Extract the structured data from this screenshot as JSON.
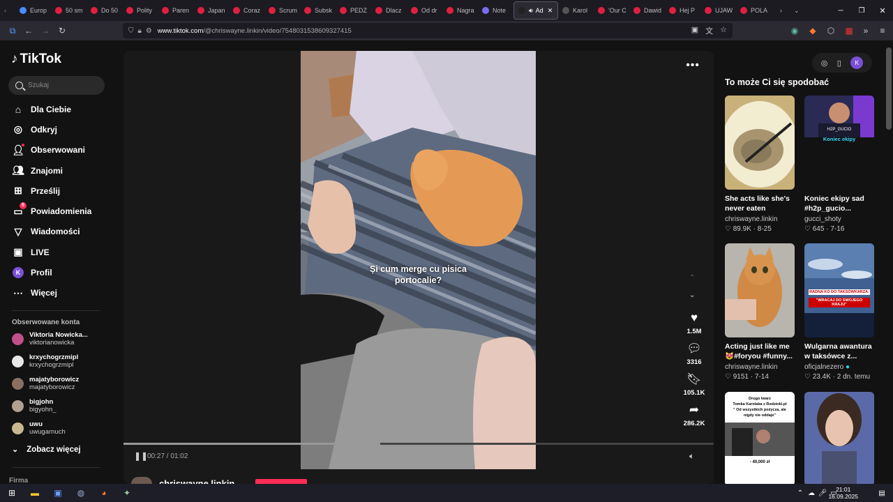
{
  "browser": {
    "tabs": [
      {
        "label": "Europ",
        "icon": "globe-icon",
        "color": "#4a8cff"
      },
      {
        "label": "50 sm",
        "icon": "youtube-icon",
        "color": "#e02040"
      },
      {
        "label": "Do 50",
        "icon": "youtube-icon",
        "color": "#e02040"
      },
      {
        "label": "Polity",
        "icon": "youtube-icon",
        "color": "#e02040"
      },
      {
        "label": "Paren",
        "icon": "youtube-icon",
        "color": "#e02040"
      },
      {
        "label": "Japan",
        "icon": "youtube-icon",
        "color": "#e02040"
      },
      {
        "label": "Coraz",
        "icon": "youtube-icon",
        "color": "#e02040"
      },
      {
        "label": "Scrum",
        "icon": "youtube-icon",
        "color": "#e02040"
      },
      {
        "label": "Subsk",
        "icon": "youtube-icon",
        "color": "#e02040"
      },
      {
        "label": "PEDZ",
        "icon": "youtube-icon",
        "color": "#e02040"
      },
      {
        "label": "Dlacz",
        "icon": "youtube-icon",
        "color": "#e02040"
      },
      {
        "label": "Od dr",
        "icon": "youtube-icon",
        "color": "#e02040"
      },
      {
        "label": "Nagra",
        "icon": "youtube-icon",
        "color": "#e02040"
      },
      {
        "label": "Note",
        "icon": "notebook-icon",
        "color": "#7a6cf0"
      },
      {
        "label": "Ad",
        "icon": "tiktok-icon",
        "color": "#222222",
        "active": true
      },
      {
        "label": "Karol",
        "icon": "x-icon",
        "color": "#555555"
      },
      {
        "label": "'Our C",
        "icon": "youtube-icon",
        "color": "#e02040"
      },
      {
        "label": "Dawid",
        "icon": "youtube-icon",
        "color": "#e02040"
      },
      {
        "label": "Hej P",
        "icon": "youtube-icon",
        "color": "#e02040"
      },
      {
        "label": "UJAW",
        "icon": "youtube-icon",
        "color": "#e02040"
      },
      {
        "label": "POLA",
        "icon": "youtube-icon",
        "color": "#e02040"
      }
    ],
    "url_host": "www.tiktok.com",
    "url_path": "/@chriswayne.linkin/video/7548031538609327415"
  },
  "sidebar": {
    "logo": "TikTok",
    "search_placeholder": "Szukaj",
    "menu": [
      {
        "label": "Dla Ciebie",
        "icon": "home-icon"
      },
      {
        "label": "Odkryj",
        "icon": "compass-icon"
      },
      {
        "label": "Obserwowani",
        "icon": "following-icon"
      },
      {
        "label": "Znajomi",
        "icon": "friends-icon"
      },
      {
        "label": "Prześlij",
        "icon": "upload-icon"
      },
      {
        "label": "Powiadomienia",
        "icon": "inbox-icon",
        "badge": "5"
      },
      {
        "label": "Wiadomości",
        "icon": "messages-icon"
      },
      {
        "label": "LIVE",
        "icon": "live-icon"
      },
      {
        "label": "Profil",
        "icon": "profile-avatar",
        "avatar_letter": "K"
      },
      {
        "label": "Więcej",
        "icon": "more-icon"
      }
    ],
    "followed_header": "Obserwowane konta",
    "followed": [
      {
        "name": "Viktoria Nowicka...",
        "handle": "viktorianowicka",
        "color": "#c0508a"
      },
      {
        "name": "krxychogrzmipl",
        "handle": "krxychogrzmipl",
        "color": "#e8e8e8"
      },
      {
        "name": "majatyborowicz",
        "handle": "majatyborowicz",
        "color": "#8a7060"
      },
      {
        "name": "bigjohn",
        "handle": "bigyohn_",
        "color": "#b0a090"
      },
      {
        "name": "uwu",
        "handle": "uwugarnuch",
        "color": "#c8b890"
      }
    ],
    "see_more": "Zobacz więcej",
    "company": "Firma"
  },
  "video": {
    "caption_line1": "Și cum merge cu pisica",
    "caption_line2": "portocalie?",
    "likes": "1.5M",
    "comments": "3316",
    "saves": "105.1K",
    "shares": "286.2K",
    "time": "00:27 / 01:02",
    "progress": 0.435,
    "author": "chriswayne.linkin"
  },
  "recommend": {
    "title": "To może Ci się spodobać",
    "items": [
      {
        "title": "She acts like she's never eaten before...",
        "author": "chriswayne.linkin",
        "likes": "89.9K",
        "date": "8-25"
      },
      {
        "title": "Koniec ekipy sad #h2p_gucio...",
        "author": "gucci_shoty",
        "likes": "645",
        "date": "7-16",
        "thumb_text": "Koniec ekipy",
        "thumb_tag": "H2P_GUCIO"
      },
      {
        "title": "Acting just like me 😻#foryou #funny...",
        "author": "chriswayne.linkin",
        "likes": "9151",
        "date": "7-14"
      },
      {
        "title": "Wulgarna awantura w taksówce z...",
        "author": "oficjalnezero",
        "likes": "23.4K",
        "date": "2 dn. temu",
        "verified": true,
        "thumb_text1": "RADNA KO DO TAKSÓWKARZA:",
        "thumb_text2": "\"WRACAJ DO SWOJEGO KRAJU\""
      },
      {
        "title": "",
        "author": "",
        "likes": "",
        "date": "",
        "thumb_text1": "Drugo twarz",
        "thumb_text2": "Tomka Karolaka z Rodzinki.pl",
        "thumb_text3": "\" Od wszystkich pożycza, ale nigdy nie oddaje\"",
        "thumb_text4": "- 40,000 zł"
      },
      {
        "title": "",
        "author": "",
        "likes": "",
        "date": ""
      }
    ]
  },
  "taskbar": {
    "time": "21:01",
    "date": "16.09.2025"
  }
}
